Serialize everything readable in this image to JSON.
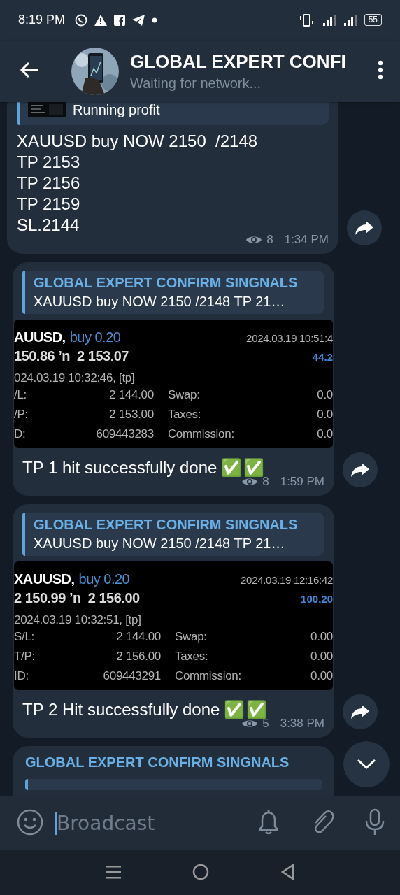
{
  "status_bar": {
    "time": "8:19 PM",
    "battery": "55"
  },
  "header": {
    "title": "GLOBAL EXPERT CONFI",
    "subtitle": "Waiting for network..."
  },
  "messages": [
    {
      "kind": "text",
      "reply": {
        "text": "Running profit"
      },
      "lines": [
        "XAUUSD buy NOW 2150  /2148",
        "TP 2153",
        "TP 2156",
        "TP 2159",
        "SL.2144"
      ],
      "views": "8",
      "time": "1:34 PM"
    },
    {
      "kind": "screenshot",
      "reply": {
        "sender": "GLOBAL EXPERT CONFIRM SINGNALS",
        "text": "XAUUSD buy NOW 2150  /2148 TP 21…"
      },
      "shot": {
        "symbol": "AUUSD,",
        "side": "buy 0.20",
        "close_time": "2024.03.19 10:51:4",
        "prices": "150.86 ’n  2 153.07",
        "profit": "44.2",
        "open_time": "024.03.19 10:32:46, [tp]",
        "fields": [
          [
            "/L:",
            "2 144.00",
            "Swap:",
            "0.0"
          ],
          [
            "/P:",
            "2 153.00",
            "Taxes:",
            "0.0"
          ],
          [
            "D:",
            "609443283",
            "Commission:",
            "0.0"
          ]
        ]
      },
      "caption": "TP 1 hit successfully done",
      "marks": "✅✅",
      "views": "8",
      "time": "1:59 PM"
    },
    {
      "kind": "screenshot",
      "reply": {
        "sender": "GLOBAL EXPERT CONFIRM SINGNALS",
        "text": "XAUUSD buy NOW 2150  /2148 TP 21…"
      },
      "shot": {
        "symbol": "XAUUSD,",
        "side": "buy 0.20",
        "close_time": "2024.03.19 12:16:42",
        "prices": "2 150.99 ’n  2 156.00",
        "profit": "100.20",
        "open_time": "2024.03.19 10:32:51, [tp]",
        "fields": [
          [
            "S/L:",
            "2 144.00",
            "Swap:",
            "0.00"
          ],
          [
            "T/P:",
            "2 156.00",
            "Taxes:",
            "0.00"
          ],
          [
            "ID:",
            "609443291",
            "Commission:",
            "0.00"
          ]
        ]
      },
      "caption": "TP 2 Hit successfully done",
      "marks": "✅✅",
      "views": "5",
      "time": "3:38 PM"
    },
    {
      "kind": "partial",
      "sender": "GLOBAL EXPERT CONFIRM SINGNALS"
    }
  ],
  "composer": {
    "placeholder": "Broadcast"
  }
}
